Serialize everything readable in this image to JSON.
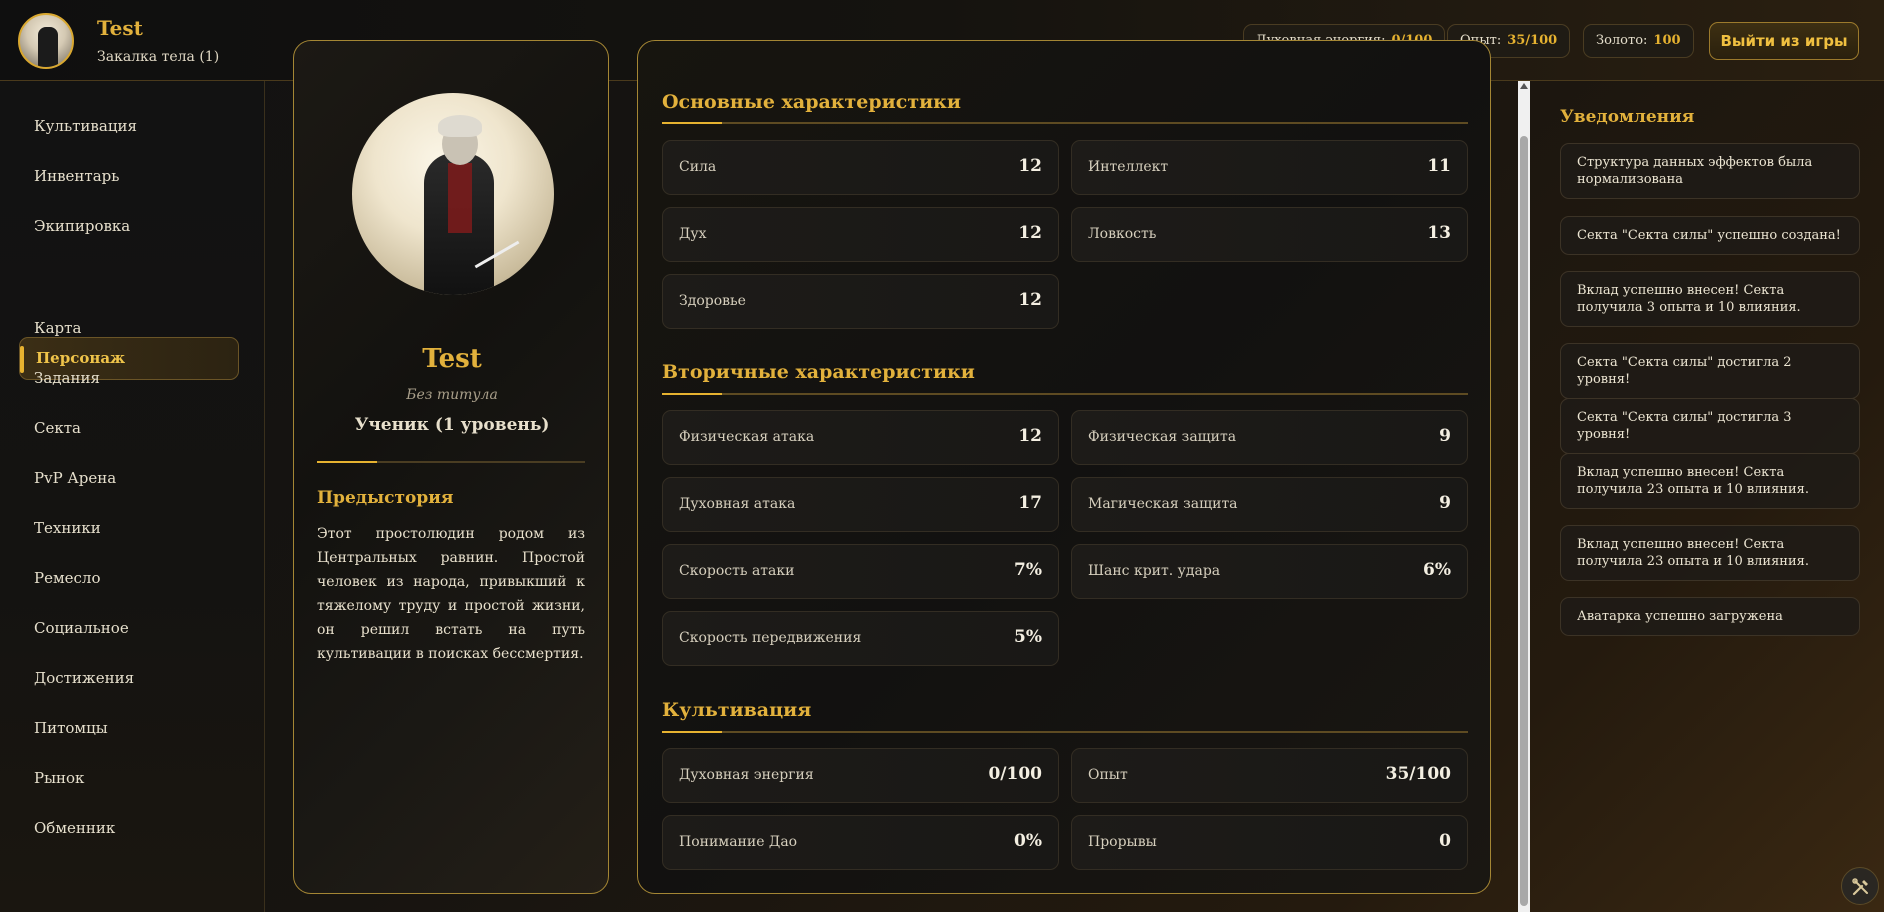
{
  "header": {
    "player_name": "Test",
    "player_stage": "Закалка тела (1)",
    "stats": [
      {
        "label": "Духовная энергия:",
        "value": "0/100"
      },
      {
        "label": "Опыт:",
        "value": "35/100"
      },
      {
        "label": "Золото:",
        "value": "100"
      }
    ],
    "exit_label": "Выйти из игры"
  },
  "sidebar": {
    "items": [
      "Культивация",
      "Инвентарь",
      "Экипировка",
      "Персонаж",
      "Карта",
      "Задания",
      "Секта",
      "PvP Арена",
      "Техники",
      "Ремесло",
      "Социальное",
      "Достижения",
      "Питомцы",
      "Рынок",
      "Обменник"
    ],
    "active": "Персонаж"
  },
  "character": {
    "name": "Test",
    "title": "Без титула",
    "rank": "Ученик (1 уровень)",
    "backstory_heading": "Предыстория",
    "backstory": "Этот простолюдин родом из Центральных равнин. Простой человек из народа, привыкший к тяжелому труду и простой жизни, он решил встать на путь культивации в поисках бессмертия."
  },
  "primary": {
    "title": "Основные характеристики",
    "stats": [
      {
        "label": "Сила",
        "value": "12"
      },
      {
        "label": "Интеллект",
        "value": "11"
      },
      {
        "label": "Дух",
        "value": "12"
      },
      {
        "label": "Ловкость",
        "value": "13"
      },
      {
        "label": "Здоровье",
        "value": "12"
      }
    ]
  },
  "secondary": {
    "title": "Вторичные характеристики",
    "stats": [
      {
        "label": "Физическая атака",
        "value": "12"
      },
      {
        "label": "Физическая защита",
        "value": "9"
      },
      {
        "label": "Духовная атака",
        "value": "17"
      },
      {
        "label": "Магическая защита",
        "value": "9"
      },
      {
        "label": "Скорость атаки",
        "value": "7%"
      },
      {
        "label": "Шанс крит. удара",
        "value": "6%"
      },
      {
        "label": "Скорость передвижения",
        "value": "5%"
      }
    ]
  },
  "cultivation": {
    "title": "Культивация",
    "stats": [
      {
        "label": "Духовная энергия",
        "value": "0/100"
      },
      {
        "label": "Опыт",
        "value": "35/100"
      },
      {
        "label": "Понимание Дао",
        "value": "0%"
      },
      {
        "label": "Прорывы",
        "value": "0"
      }
    ]
  },
  "notifications": {
    "title": "Уведомления",
    "items": [
      "Структура данных эффектов была нормализована",
      "Секта \"Секта силы\" успешно создана!",
      "Вклад успешно внесен! Секта получила 3 опыта и 10 влияния.",
      "Секта \"Секта силы\" достигла 2 уровня!",
      "Секта \"Секта силы\" достигла 3 уровня!",
      "Вклад успешно внесен! Секта получила 23 опыта и 10 влияния.",
      "Вклад успешно внесен! Секта получила 23 опыта и 10 влияния.",
      "Аватарка успешно загружена"
    ]
  },
  "icons": {
    "tools": "tools-icon"
  },
  "colors": {
    "accent": "#e2b13c",
    "border": "#a48634"
  }
}
